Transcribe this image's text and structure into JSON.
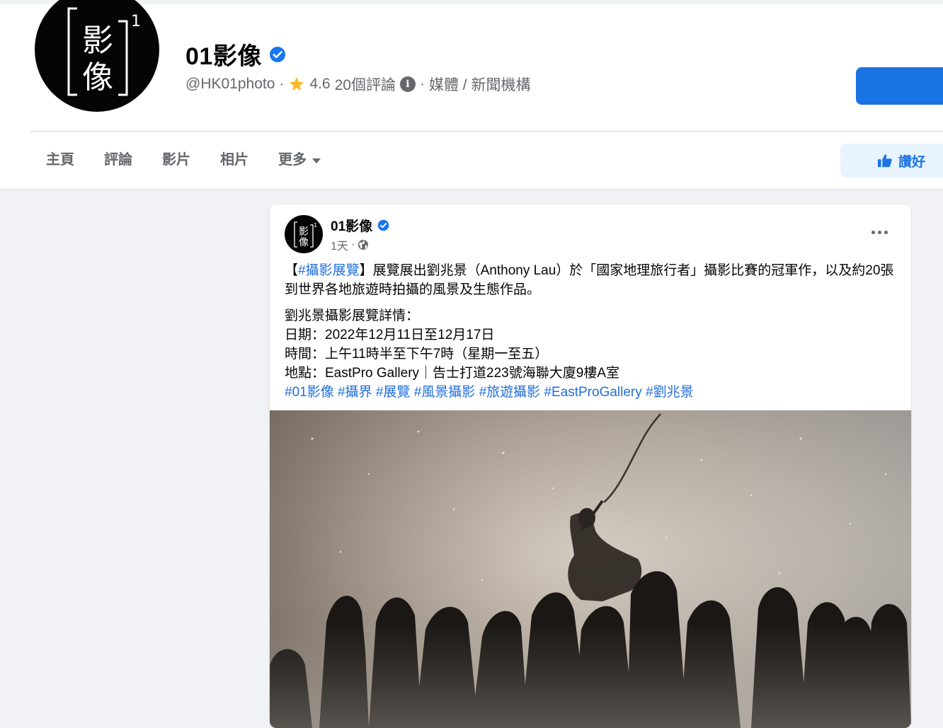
{
  "page": {
    "name": "01影像",
    "handle": "@HK01photo",
    "rating": "4.6",
    "reviews": "20個評論",
    "category": "媒體 / 新聞機構",
    "separator": "·",
    "avatar_text": "影像",
    "avatar_superscript": "1"
  },
  "tabs": [
    {
      "label": "主頁"
    },
    {
      "label": "評論"
    },
    {
      "label": "影片"
    },
    {
      "label": "相片"
    },
    {
      "label": "更多"
    }
  ],
  "like_button": {
    "label": "讚好"
  },
  "post": {
    "author": "01影像",
    "time": "1天",
    "time_separator": "·",
    "text": {
      "bracket_open": "【",
      "tag": "#攝影展覽",
      "bracket_close": "】",
      "intro": "展覽展出劉兆景（Anthony Lau）於「國家地理旅行者」攝影比賽的冠軍作，以及約20張到世界各地旅遊時拍攝的風景及生態作品。",
      "details_title": "劉兆景攝影展覽詳情：",
      "date": "日期：2022年12月11日至12月17日",
      "time": "時間：上午11時半至下午7時（星期一至五）",
      "location": "地點：EastPro Gallery｜告士打道223號海聯大廈9樓A室"
    },
    "hashtags": [
      "#01影像",
      "#攝界",
      "#展覽",
      "#風景攝影",
      "#旅遊攝影",
      "#EastProGallery",
      "#劉兆景"
    ]
  },
  "icons": {
    "verified": "verified-badge-icon",
    "star": "star-icon",
    "info": "info-icon",
    "globe": "globe-icon",
    "like": "thumbs-up-icon",
    "more": "more-options-icon",
    "dropdown": "caret-down-icon"
  },
  "colors": {
    "brand_blue": "#1b74e4",
    "hashtag_blue": "#216fdb",
    "star": "#f7b928",
    "muted_text": "#65676b",
    "background": "#f0f2f5"
  }
}
